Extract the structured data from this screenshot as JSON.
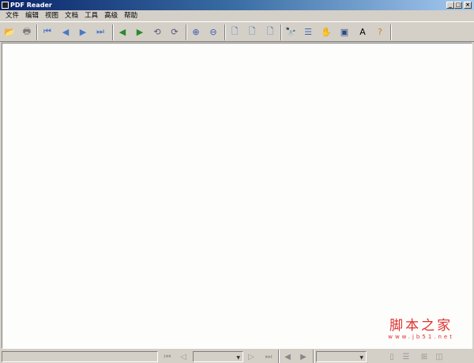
{
  "window": {
    "title": "PDF Reader",
    "minimize": "_",
    "maximize": "□",
    "close": "×"
  },
  "menu": [
    "文件",
    "编辑",
    "视图",
    "文档",
    "工具",
    "高级",
    "帮助"
  ],
  "toolbar": [
    {
      "icon": "open-folder-icon",
      "glyph": "📂",
      "color": "#e0a020"
    },
    {
      "icon": "print-icon",
      "glyph": "🖶",
      "color": "#777"
    },
    {
      "icon": "first-page-icon",
      "glyph": "⏮",
      "color": "#4a78c8"
    },
    {
      "icon": "prev-page-icon",
      "glyph": "◀",
      "color": "#4a78c8"
    },
    {
      "icon": "next-page-icon",
      "glyph": "▶",
      "color": "#4a78c8"
    },
    {
      "icon": "last-page-icon",
      "glyph": "⏭",
      "color": "#4a78c8"
    },
    {
      "icon": "back-icon",
      "glyph": "◀",
      "color": "#2a8a2a"
    },
    {
      "icon": "forward-icon",
      "glyph": "▶",
      "color": "#2a8a2a"
    },
    {
      "icon": "rotate-left-icon",
      "glyph": "⟲",
      "color": "#557"
    },
    {
      "icon": "rotate-right-icon",
      "glyph": "⟳",
      "color": "#557"
    },
    {
      "icon": "zoom-in-icon",
      "glyph": "⊕",
      "color": "#3a5ab0"
    },
    {
      "icon": "zoom-out-icon",
      "glyph": "⊖",
      "color": "#3a5ab0"
    },
    {
      "icon": "actual-size-icon",
      "glyph": "🗋",
      "color": "#3a6ab8"
    },
    {
      "icon": "fit-page-icon",
      "glyph": "🗋",
      "color": "#3a6ab8"
    },
    {
      "icon": "fit-width-icon",
      "glyph": "🗋",
      "color": "#3a6ab8"
    },
    {
      "icon": "find-icon",
      "glyph": "🔭",
      "color": "#3040a0"
    },
    {
      "icon": "bookmarks-icon",
      "glyph": "☰",
      "color": "#3a6ab8"
    },
    {
      "icon": "hand-tool-icon",
      "glyph": "✋",
      "color": "#888"
    },
    {
      "icon": "snapshot-icon",
      "glyph": "▣",
      "color": "#2a4a8a"
    },
    {
      "icon": "text-select-icon",
      "glyph": "A",
      "color": "#000"
    },
    {
      "icon": "help-icon",
      "glyph": "?",
      "color": "#d08020"
    }
  ],
  "status": {
    "page_combo": "",
    "zoom_combo": ""
  },
  "watermark": {
    "title": "脚本之家",
    "url": "www.jb51.net"
  }
}
